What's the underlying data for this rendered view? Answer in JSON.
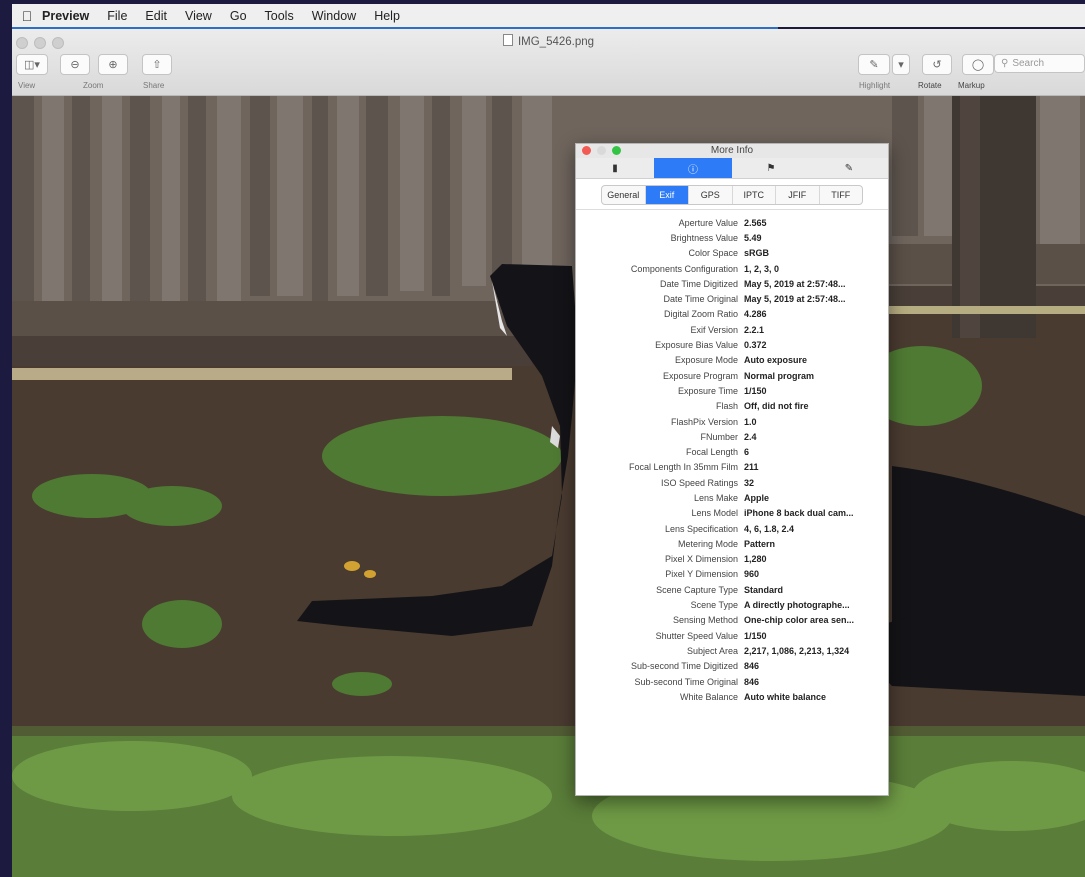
{
  "menubar": {
    "items": [
      "Preview",
      "File",
      "Edit",
      "View",
      "Go",
      "Tools",
      "Window",
      "Help"
    ]
  },
  "window": {
    "title": "IMG_5426.png",
    "toolbar": {
      "view_label": "View",
      "zoom_label": "Zoom",
      "share_label": "Share",
      "highlight_label": "Highlight",
      "rotate_label": "Rotate",
      "markup_label": "Markup",
      "search_placeholder": "Search"
    }
  },
  "inspector": {
    "title": "More Info",
    "tabs": [
      "general-icon",
      "info-icon",
      "tags-icon",
      "annotate-icon"
    ],
    "segments": [
      "General",
      "Exif",
      "GPS",
      "IPTC",
      "JFIF",
      "TIFF"
    ],
    "active_segment": "Exif",
    "rows": [
      {
        "k": "Aperture Value",
        "v": "2.565"
      },
      {
        "k": "Brightness Value",
        "v": "5.49"
      },
      {
        "k": "Color Space",
        "v": "sRGB"
      },
      {
        "k": "Components Configuration",
        "v": "1, 2, 3, 0"
      },
      {
        "k": "Date Time Digitized",
        "v": "May 5, 2019 at 2:57:48..."
      },
      {
        "k": "Date Time Original",
        "v": "May 5, 2019 at 2:57:48..."
      },
      {
        "k": "Digital Zoom Ratio",
        "v": "4.286"
      },
      {
        "k": "Exif Version",
        "v": "2.2.1"
      },
      {
        "k": "Exposure Bias Value",
        "v": "0.372"
      },
      {
        "k": "Exposure Mode",
        "v": "Auto exposure"
      },
      {
        "k": "Exposure Program",
        "v": "Normal program"
      },
      {
        "k": "Exposure Time",
        "v": "1/150"
      },
      {
        "k": "Flash",
        "v": "Off, did not fire"
      },
      {
        "k": "FlashPix Version",
        "v": "1.0"
      },
      {
        "k": "FNumber",
        "v": "2.4"
      },
      {
        "k": "Focal Length",
        "v": "6"
      },
      {
        "k": "Focal Length In 35mm Film",
        "v": "211"
      },
      {
        "k": "ISO Speed Ratings",
        "v": "32"
      },
      {
        "k": "Lens Make",
        "v": "Apple"
      },
      {
        "k": "Lens Model",
        "v": "iPhone 8 back dual cam..."
      },
      {
        "k": "Lens Specification",
        "v": "4, 6, 1.8, 2.4"
      },
      {
        "k": "Metering Mode",
        "v": "Pattern"
      },
      {
        "k": "Pixel X Dimension",
        "v": "1,280"
      },
      {
        "k": "Pixel Y Dimension",
        "v": "960"
      },
      {
        "k": "Scene Capture Type",
        "v": "Standard"
      },
      {
        "k": "Scene Type",
        "v": "A directly photographe..."
      },
      {
        "k": "Sensing Method",
        "v": "One-chip color area sen..."
      },
      {
        "k": "Shutter Speed Value",
        "v": "1/150"
      },
      {
        "k": "Subject Area",
        "v": "2,217, 1,086, 2,213, 1,324"
      },
      {
        "k": "Sub-second Time Digitized",
        "v": "846"
      },
      {
        "k": "Sub-second Time Original",
        "v": "846"
      },
      {
        "k": "White Balance",
        "v": "Auto white balance"
      }
    ]
  }
}
